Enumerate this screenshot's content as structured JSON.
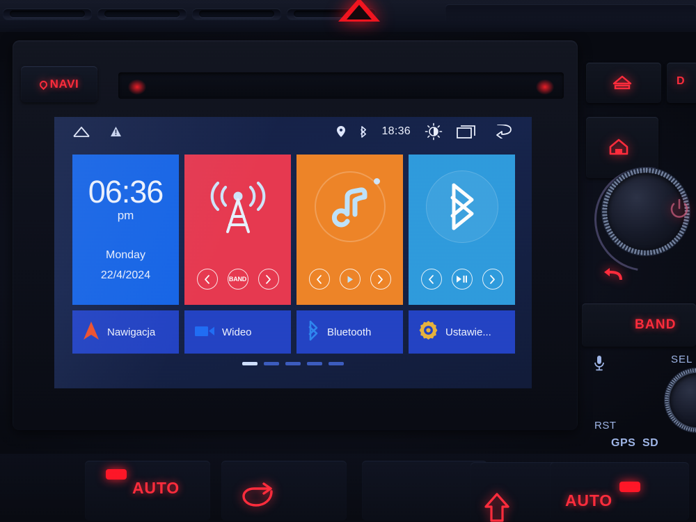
{
  "device": {
    "name": "car-head-unit",
    "bezel_buttons": {
      "navi_label": "NAVI",
      "navi_icon": "map-pin-icon",
      "eject_icon": "eject-icon",
      "home_icon": "home-icon",
      "power_icon": "power-icon",
      "back_icon": "back-arrow-icon",
      "band_label": "BAND",
      "mic_icon": "microphone-icon",
      "rst_label": "RST",
      "gps_label": "GPS",
      "sd_label": "SD",
      "sel_label": "SEL"
    },
    "climate": {
      "auto_left_label": "AUTO",
      "auto_right_label": "AUTO",
      "recirculate_icon": "recirculate-icon",
      "airflow_icon": "airflow-up-icon",
      "hazard_icon": "hazard-triangle-icon"
    }
  },
  "screen": {
    "statusbar": {
      "home_icon": "home-icon",
      "warning_icon": "warning-triangle-icon",
      "location_icon": "location-pin-icon",
      "bluetooth_icon": "bluetooth-icon",
      "time": "18:36",
      "brightness_icon": "brightness-icon",
      "recents_icon": "recents-icon",
      "back_icon": "back-icon"
    },
    "widgets": [
      {
        "id": "clock",
        "name": "clock-widget",
        "color": "#1565e8",
        "time": "06:36",
        "ampm": "pm",
        "weekday": "Monday",
        "date": "22/4/2024"
      },
      {
        "id": "radio",
        "name": "radio-widget",
        "color": "#e8384f",
        "icon": "radio-tower-icon",
        "controls": [
          "prev",
          "BAND",
          "next"
        ],
        "band_label": "BAND"
      },
      {
        "id": "music",
        "name": "music-widget",
        "color": "#ef8427",
        "icon": "music-note-icon",
        "controls": [
          "prev",
          "play",
          "next"
        ]
      },
      {
        "id": "bluetooth-music",
        "name": "bluetooth-music-widget",
        "color": "#2e9bdd",
        "icon": "bluetooth-icon",
        "controls": [
          "prev",
          "play-pause",
          "next"
        ]
      }
    ],
    "shortcuts": [
      {
        "label": "Nawigacja",
        "icon": "navigation-arrow-icon",
        "accent": "#f2502a"
      },
      {
        "label": "Wideo",
        "icon": "video-camera-icon",
        "accent": "#1f6df5"
      },
      {
        "label": "Bluetooth",
        "icon": "bluetooth-icon",
        "accent": "#2e86f0"
      },
      {
        "label": "Ustawie...",
        "icon": "gear-icon",
        "accent": "#e8b33c"
      }
    ],
    "pager": {
      "count": 5,
      "active_index": 0
    }
  }
}
